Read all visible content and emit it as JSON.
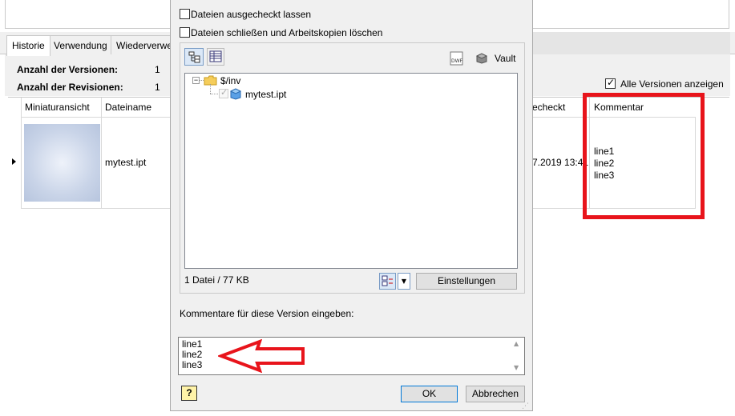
{
  "background_window": {
    "tabs": [
      {
        "label": "Historie",
        "active": true
      },
      {
        "label": "Verwendung",
        "active": false
      },
      {
        "label": "Wiederverwe",
        "active": false
      }
    ],
    "info": {
      "versions_label": "Anzahl der Versionen:",
      "versions_value": "1",
      "revisions_label": "Anzahl der Revisionen:",
      "revisions_value": "1"
    },
    "show_all_versions": {
      "label": "Alle Versionen anzeigen",
      "checked": true
    },
    "grid": {
      "columns": [
        "Miniaturansicht",
        "Dateiname",
        "ec%heckt",
        "Kommentar"
      ],
      "col_thumbnail": "Miniaturansicht",
      "col_filename": "Dateiname",
      "col_checked_in": "echeckt",
      "col_comment": "Kommentar",
      "row": {
        "filename": "mytest.ipt",
        "checked_in_date": "7.2019 13:41",
        "comment_lines": [
          "line1",
          "line2",
          "line3"
        ]
      }
    },
    "annotation_color": "#e8141b"
  },
  "dialog": {
    "keep_checked_out": {
      "label": "Dateien ausgecheckt lassen",
      "checked": false
    },
    "close_files": {
      "label": "Dateien schließen und Arbeitskopien löschen",
      "checked": false
    },
    "toolbar": {
      "tree_view_icon": "tree-view-icon",
      "grid_view_icon": "grid-view-icon",
      "dwf_icon": "dwf-icon",
      "vault_label": "Vault"
    },
    "tree": {
      "root_label": "$/inv",
      "file_label": "mytest.ipt"
    },
    "file_summary": "1 Datei / 77 KB",
    "settings_button": "Einstellungen",
    "comment_prompt": "Kommentare für diese Version eingeben:",
    "comment_lines": [
      "line1",
      "line2",
      "line3"
    ],
    "ok_button": "OK",
    "cancel_button": "Abbrechen",
    "help_icon": "help-icon"
  }
}
